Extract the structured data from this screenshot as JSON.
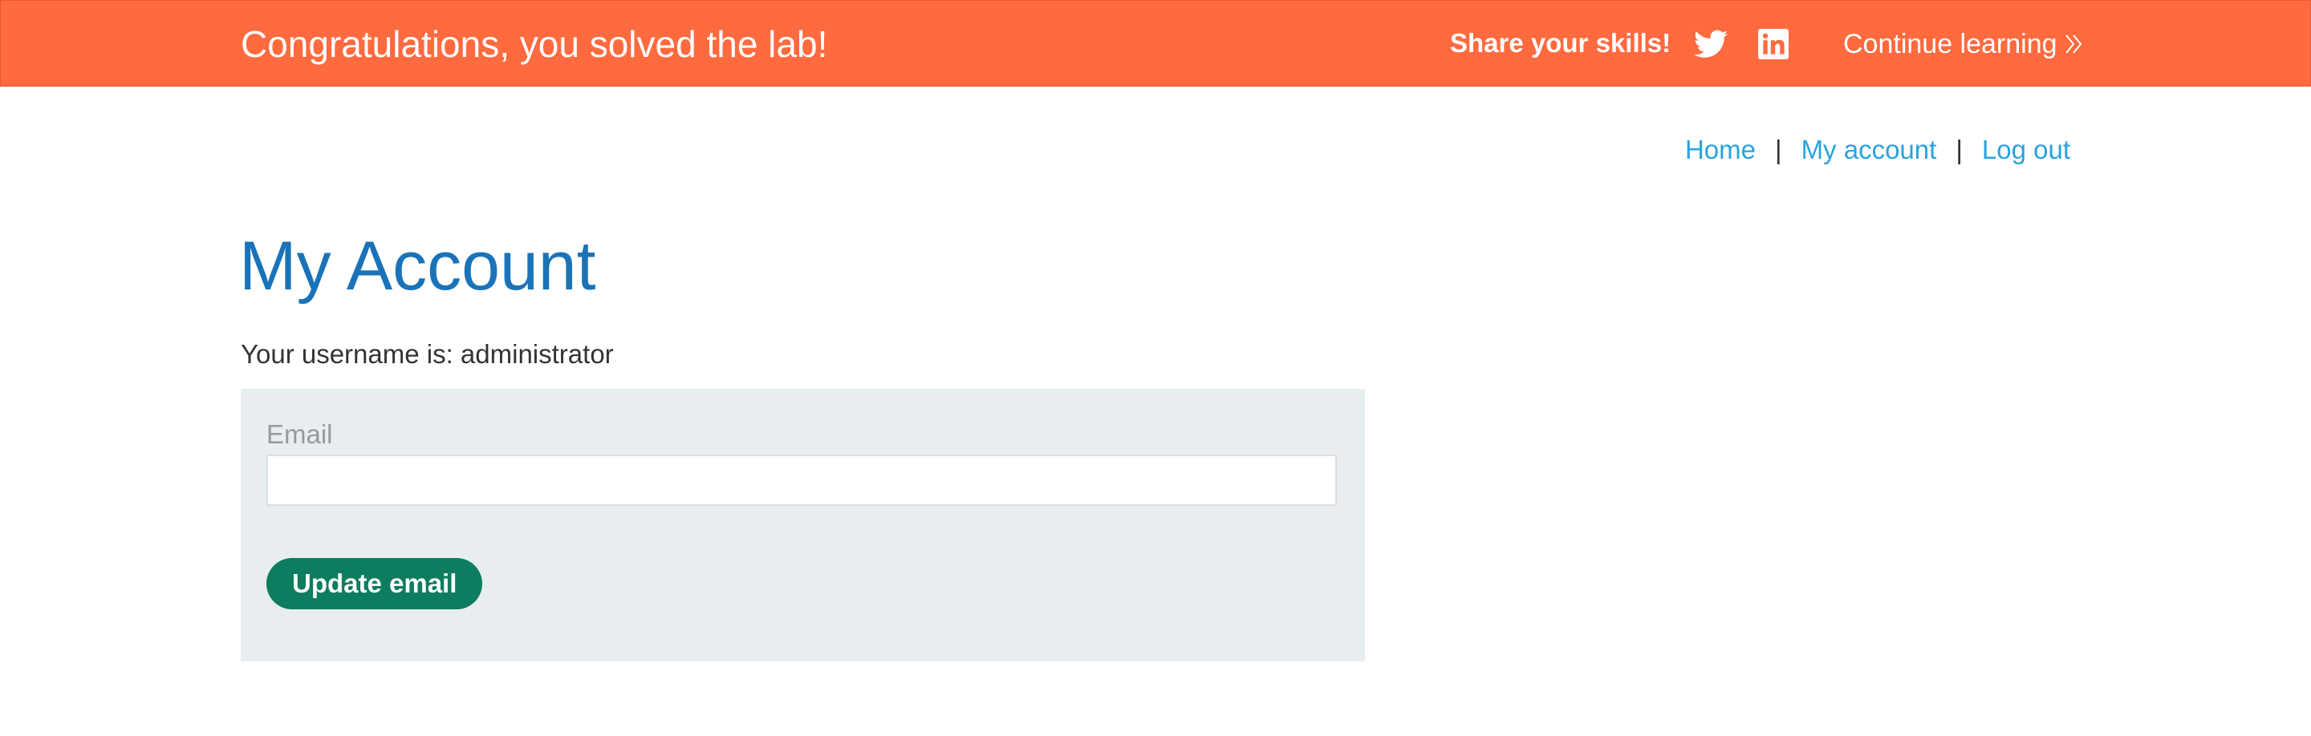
{
  "banner": {
    "title": "Congratulations, you solved the lab!",
    "share_label": "Share your skills!",
    "twitter_icon": "twitter-icon",
    "linkedin_icon": "linkedin-icon",
    "continue_label": "Continue learning",
    "continue_icon": "double-chevron-right-icon",
    "background_color": "#ff6a3f"
  },
  "nav": {
    "items": [
      {
        "label": "Home"
      },
      {
        "label": "My account"
      },
      {
        "label": "Log out"
      }
    ],
    "separator": "|",
    "link_color": "#29a3dd"
  },
  "main": {
    "title": "My Account",
    "username_line": "Your username is: administrator",
    "title_color": "#1a73b8"
  },
  "form": {
    "email_label": "Email",
    "email_value": "",
    "email_placeholder": "",
    "submit_label": "Update email",
    "button_color": "#0e7c5f",
    "panel_color": "#e8eef0"
  }
}
